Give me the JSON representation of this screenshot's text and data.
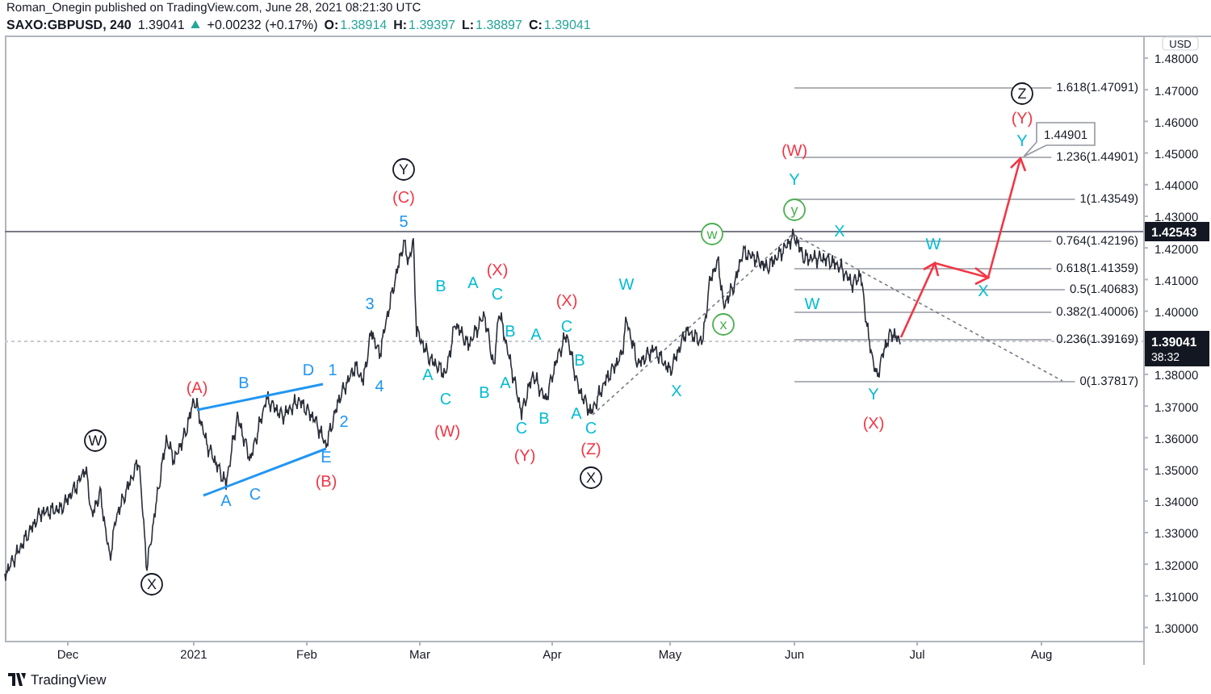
{
  "header": {
    "byline": "Roman_Onegin published on TradingView.com, June 28, 2021 08:21:30 UTC",
    "symbol": "SAXO:GBPUSD, 240",
    "last": "1.39041",
    "change": "+0.00232 (+0.17%)",
    "ohlc": [
      {
        "label": "O:",
        "value": "1.38914"
      },
      {
        "label": "H:",
        "value": "1.39397"
      },
      {
        "label": "L:",
        "value": "1.38897"
      },
      {
        "label": "C:",
        "value": "1.39041"
      }
    ]
  },
  "chart": {
    "wave_labels": [
      {
        "text": "Z",
        "kind": "circle",
        "color": "#131722"
      },
      {
        "text": "(Y)",
        "kind": "plain",
        "color": "#f23645"
      },
      {
        "text": "(W)",
        "kind": "plain",
        "color": "#f23645"
      },
      {
        "text": "Y",
        "kind": "plain",
        "color": "#00bcd4"
      },
      {
        "text": "Y",
        "kind": "circle",
        "color": "#131722"
      },
      {
        "text": "Y",
        "kind": "plain",
        "color": "#00bcd4"
      },
      {
        "text": "(C)",
        "kind": "plain",
        "color": "#f23645"
      },
      {
        "text": "5",
        "kind": "plain",
        "color": "#2196f3"
      },
      {
        "text": "y",
        "kind": "circle",
        "color": "#4caf50"
      },
      {
        "text": "w",
        "kind": "circle",
        "color": "#4caf50"
      },
      {
        "text": "X",
        "kind": "plain",
        "color": "#00bcd4"
      },
      {
        "text": "W",
        "kind": "plain",
        "color": "#00bcd4"
      },
      {
        "text": "(X)",
        "kind": "plain",
        "color": "#f23645"
      },
      {
        "text": "B",
        "kind": "plain",
        "color": "#00bcd4"
      },
      {
        "text": "A",
        "kind": "plain",
        "color": "#00bcd4"
      },
      {
        "text": "C",
        "kind": "plain",
        "color": "#00bcd4"
      },
      {
        "text": "W",
        "kind": "plain",
        "color": "#00bcd4"
      },
      {
        "text": "X",
        "kind": "plain",
        "color": "#00bcd4"
      },
      {
        "text": "3",
        "kind": "plain",
        "color": "#2196f3"
      },
      {
        "text": "(X)",
        "kind": "plain",
        "color": "#f23645"
      },
      {
        "text": "W",
        "kind": "plain",
        "color": "#00bcd4"
      },
      {
        "text": "B",
        "kind": "plain",
        "color": "#00bcd4"
      },
      {
        "text": "A",
        "kind": "plain",
        "color": "#00bcd4"
      },
      {
        "text": "C",
        "kind": "plain",
        "color": "#00bcd4"
      },
      {
        "text": "x",
        "kind": "circle",
        "color": "#4caf50"
      },
      {
        "text": "D",
        "kind": "plain",
        "color": "#2196f3"
      },
      {
        "text": "1",
        "kind": "plain",
        "color": "#2196f3"
      },
      {
        "text": "B",
        "kind": "plain",
        "color": "#00bcd4"
      },
      {
        "text": "A",
        "kind": "plain",
        "color": "#00bcd4"
      },
      {
        "text": "(A)",
        "kind": "plain",
        "color": "#f23645"
      },
      {
        "text": "B",
        "kind": "plain",
        "color": "#2196f3"
      },
      {
        "text": "4",
        "kind": "plain",
        "color": "#2196f3"
      },
      {
        "text": "C",
        "kind": "plain",
        "color": "#00bcd4"
      },
      {
        "text": "B",
        "kind": "plain",
        "color": "#00bcd4"
      },
      {
        "text": "A",
        "kind": "plain",
        "color": "#00bcd4"
      },
      {
        "text": "X",
        "kind": "plain",
        "color": "#00bcd4"
      },
      {
        "text": "Y",
        "kind": "plain",
        "color": "#00bcd4"
      },
      {
        "text": "2",
        "kind": "plain",
        "color": "#2196f3"
      },
      {
        "text": "(W)",
        "kind": "plain",
        "color": "#f23645"
      },
      {
        "text": "C",
        "kind": "plain",
        "color": "#00bcd4"
      },
      {
        "text": "B",
        "kind": "plain",
        "color": "#00bcd4"
      },
      {
        "text": "A",
        "kind": "plain",
        "color": "#00bcd4"
      },
      {
        "text": "C",
        "kind": "plain",
        "color": "#00bcd4"
      },
      {
        "text": "(X)",
        "kind": "plain",
        "color": "#f23645"
      },
      {
        "text": "W",
        "kind": "circle",
        "color": "#131722"
      },
      {
        "text": "E",
        "kind": "plain",
        "color": "#2196f3"
      },
      {
        "text": "(Y)",
        "kind": "plain",
        "color": "#f23645"
      },
      {
        "text": "(Z)",
        "kind": "plain",
        "color": "#f23645"
      },
      {
        "text": "(B)",
        "kind": "plain",
        "color": "#f23645"
      },
      {
        "text": "X",
        "kind": "circle",
        "color": "#131722"
      },
      {
        "text": "A",
        "kind": "plain",
        "color": "#2196f3"
      },
      {
        "text": "C",
        "kind": "plain",
        "color": "#2196f3"
      },
      {
        "text": "X",
        "kind": "circle",
        "color": "#131722"
      }
    ],
    "fib_levels": [
      {
        "label": "1.618(1.47091)"
      },
      {
        "label": "1.236(1.44901)"
      },
      {
        "label": "1(1.43549)"
      },
      {
        "label": "0.764(1.42196)"
      },
      {
        "label": "0.618(1.41359)"
      },
      {
        "label": "0.5(1.40683)"
      },
      {
        "label": "0.382(1.40006)"
      },
      {
        "label": "0.236(1.39169)"
      },
      {
        "label": "0(1.37817)"
      }
    ],
    "price_callout": "1.44901",
    "price_axis": {
      "unit": "USD",
      "ticks": [
        "1.48000",
        "1.47000",
        "1.46000",
        "1.45000",
        "1.44000",
        "1.43000",
        "1.42000",
        "1.41000",
        "1.40000",
        "1.38000",
        "1.37000",
        "1.36000",
        "1.35000",
        "1.34000",
        "1.33000",
        "1.32000",
        "1.31000",
        "1.30000"
      ],
      "level_marker": "1.42543",
      "last_price": "1.39041",
      "countdown": "38:32"
    },
    "time_axis": {
      "ticks": [
        "Dec",
        "2021",
        "Feb",
        "Mar",
        "Apr",
        "May",
        "Jun",
        "Jul",
        "Aug"
      ]
    }
  },
  "footer": {
    "brand": "TradingView"
  }
}
